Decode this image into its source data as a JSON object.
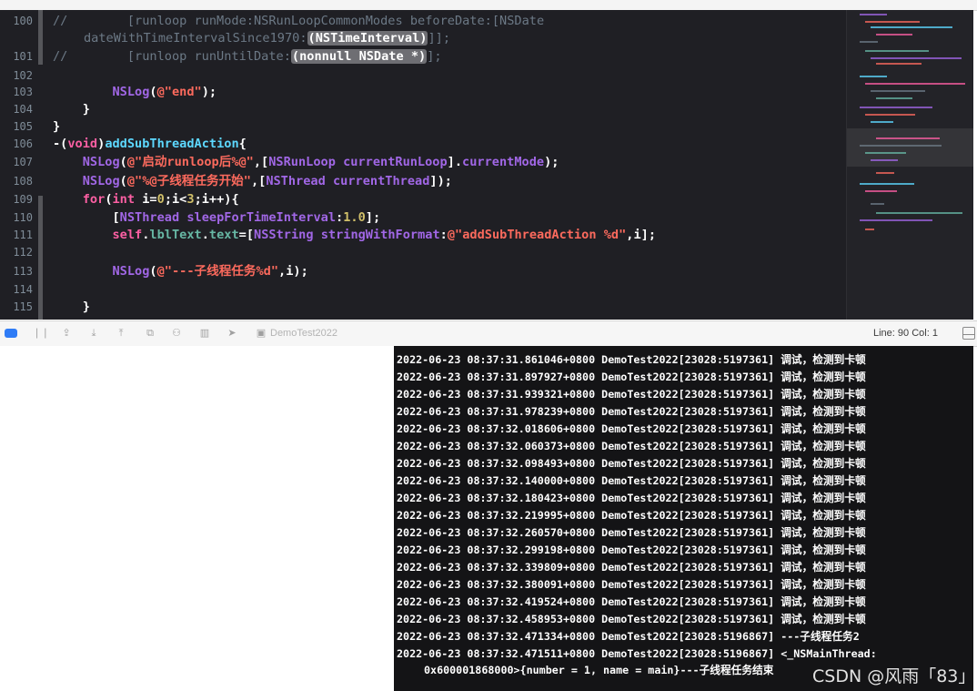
{
  "editor": {
    "lines": [
      {
        "no": "100",
        "segments": [
          {
            "t": "//        [runloop runMode:NSRunLoopCommonModes beforeDate:[NSDate",
            "c": "cmt"
          }
        ]
      },
      {
        "no": "",
        "continuation": true,
        "segments": [
          {
            "t": "dateWithTimeIntervalSince1970:",
            "c": "cmt"
          },
          {
            "t": "(NSTimeInterval)",
            "c": "hl"
          },
          {
            "t": "]];",
            "c": "cmt"
          }
        ]
      },
      {
        "no": "101",
        "segments": [
          {
            "t": "//        [runloop runUntilDate:",
            "c": "cmt"
          },
          {
            "t": "(nonnull NSDate *)",
            "c": "hl"
          },
          {
            "t": "];",
            "c": "cmt"
          }
        ]
      },
      {
        "no": "102",
        "segments": []
      },
      {
        "no": "103",
        "segments": [
          {
            "t": "        ",
            "c": "pl"
          },
          {
            "t": "NSLog",
            "c": "mth"
          },
          {
            "t": "(",
            "c": "pl"
          },
          {
            "t": "@\"end\"",
            "c": "str"
          },
          {
            "t": ");",
            "c": "pl"
          }
        ]
      },
      {
        "no": "104",
        "segments": [
          {
            "t": "    }",
            "c": "pl"
          }
        ]
      },
      {
        "no": "105",
        "segments": [
          {
            "t": "}",
            "c": "pl"
          }
        ]
      },
      {
        "no": "106",
        "segments": [
          {
            "t": "-(",
            "c": "pl"
          },
          {
            "t": "void",
            "c": "kw"
          },
          {
            "t": ")",
            "c": "pl"
          },
          {
            "t": "addSubThreadAction",
            "c": "fn"
          },
          {
            "t": "{",
            "c": "pl"
          }
        ]
      },
      {
        "no": "107",
        "segments": [
          {
            "t": "    ",
            "c": "pl"
          },
          {
            "t": "NSLog",
            "c": "mth"
          },
          {
            "t": "(",
            "c": "pl"
          },
          {
            "t": "@\"启动runloop后%@\"",
            "c": "str"
          },
          {
            "t": ",[",
            "c": "pl"
          },
          {
            "t": "NSRunLoop",
            "c": "cls"
          },
          {
            "t": " ",
            "c": "pl"
          },
          {
            "t": "currentRunLoop",
            "c": "mth"
          },
          {
            "t": "].",
            "c": "pl"
          },
          {
            "t": "currentMode",
            "c": "mth"
          },
          {
            "t": ");",
            "c": "pl"
          }
        ]
      },
      {
        "no": "108",
        "segments": [
          {
            "t": "    ",
            "c": "pl"
          },
          {
            "t": "NSLog",
            "c": "mth"
          },
          {
            "t": "(",
            "c": "pl"
          },
          {
            "t": "@\"%@子线程任务开始\"",
            "c": "str"
          },
          {
            "t": ",[",
            "c": "pl"
          },
          {
            "t": "NSThread",
            "c": "cls"
          },
          {
            "t": " ",
            "c": "pl"
          },
          {
            "t": "currentThread",
            "c": "mth"
          },
          {
            "t": "]);",
            "c": "pl"
          }
        ]
      },
      {
        "no": "109",
        "segments": [
          {
            "t": "    ",
            "c": "pl"
          },
          {
            "t": "for",
            "c": "kw"
          },
          {
            "t": "(",
            "c": "pl"
          },
          {
            "t": "int",
            "c": "kw"
          },
          {
            "t": " i=",
            "c": "pl"
          },
          {
            "t": "0",
            "c": "num"
          },
          {
            "t": ";i<",
            "c": "pl"
          },
          {
            "t": "3",
            "c": "num"
          },
          {
            "t": ";i++){",
            "c": "pl"
          }
        ]
      },
      {
        "no": "110",
        "segments": [
          {
            "t": "        [",
            "c": "pl"
          },
          {
            "t": "NSThread",
            "c": "cls"
          },
          {
            "t": " ",
            "c": "pl"
          },
          {
            "t": "sleepForTimeInterval",
            "c": "mth"
          },
          {
            "t": ":",
            "c": "pl"
          },
          {
            "t": "1.0",
            "c": "num"
          },
          {
            "t": "];",
            "c": "pl"
          }
        ]
      },
      {
        "no": "111",
        "segments": [
          {
            "t": "        ",
            "c": "pl"
          },
          {
            "t": "self",
            "c": "kw"
          },
          {
            "t": ".",
            "c": "pl"
          },
          {
            "t": "lblText",
            "c": "prop"
          },
          {
            "t": ".",
            "c": "pl"
          },
          {
            "t": "text",
            "c": "prop"
          },
          {
            "t": "=[",
            "c": "pl"
          },
          {
            "t": "NSString",
            "c": "cls"
          },
          {
            "t": " ",
            "c": "pl"
          },
          {
            "t": "stringWithFormat",
            "c": "mth"
          },
          {
            "t": ":",
            "c": "pl"
          },
          {
            "t": "@\"addSubThreadAction %d\"",
            "c": "str"
          },
          {
            "t": ",i];",
            "c": "pl"
          }
        ]
      },
      {
        "no": "112",
        "segments": []
      },
      {
        "no": "113",
        "segments": [
          {
            "t": "        ",
            "c": "pl"
          },
          {
            "t": "NSLog",
            "c": "mth"
          },
          {
            "t": "(",
            "c": "pl"
          },
          {
            "t": "@\"---子线程任务%d\"",
            "c": "str"
          },
          {
            "t": ",i);",
            "c": "pl"
          }
        ]
      },
      {
        "no": "114",
        "segments": []
      },
      {
        "no": "115",
        "segments": [
          {
            "t": "    }",
            "c": "pl"
          }
        ]
      }
    ]
  },
  "debugbar": {
    "target": "DemoTest2022",
    "line_col": "Line: 90  Col: 1"
  },
  "console": {
    "lines": [
      "2022-06-23 08:37:31.861046+0800 DemoTest2022[23028:5197361] 调试，检测到卡顿",
      "2022-06-23 08:37:31.897927+0800 DemoTest2022[23028:5197361] 调试，检测到卡顿",
      "2022-06-23 08:37:31.939321+0800 DemoTest2022[23028:5197361] 调试，检测到卡顿",
      "2022-06-23 08:37:31.978239+0800 DemoTest2022[23028:5197361] 调试，检测到卡顿",
      "2022-06-23 08:37:32.018606+0800 DemoTest2022[23028:5197361] 调试，检测到卡顿",
      "2022-06-23 08:37:32.060373+0800 DemoTest2022[23028:5197361] 调试，检测到卡顿",
      "2022-06-23 08:37:32.098493+0800 DemoTest2022[23028:5197361] 调试，检测到卡顿",
      "2022-06-23 08:37:32.140000+0800 DemoTest2022[23028:5197361] 调试，检测到卡顿",
      "2022-06-23 08:37:32.180423+0800 DemoTest2022[23028:5197361] 调试，检测到卡顿",
      "2022-06-23 08:37:32.219995+0800 DemoTest2022[23028:5197361] 调试，检测到卡顿",
      "2022-06-23 08:37:32.260570+0800 DemoTest2022[23028:5197361] 调试，检测到卡顿",
      "2022-06-23 08:37:32.299198+0800 DemoTest2022[23028:5197361] 调试，检测到卡顿",
      "2022-06-23 08:37:32.339809+0800 DemoTest2022[23028:5197361] 调试，检测到卡顿",
      "2022-06-23 08:37:32.380091+0800 DemoTest2022[23028:5197361] 调试，检测到卡顿",
      "2022-06-23 08:37:32.419524+0800 DemoTest2022[23028:5197361] 调试，检测到卡顿",
      "2022-06-23 08:37:32.458953+0800 DemoTest2022[23028:5197361] 调试，检测到卡顿",
      "2022-06-23 08:37:32.471334+0800 DemoTest2022[23028:5196867] ---子线程任务2",
      "2022-06-23 08:37:32.471511+0800 DemoTest2022[23028:5196867] <_NSMainThread:",
      "0x600001868000>{number = 1, name = main}---子线程任务结束"
    ]
  },
  "watermark": "CSDN @风雨「83」"
}
